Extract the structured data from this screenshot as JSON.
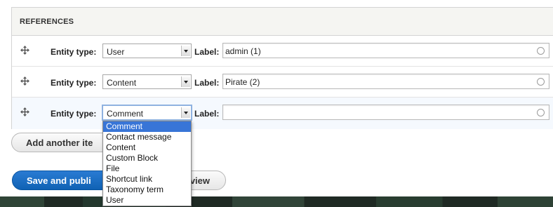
{
  "section_title": "REFERENCES",
  "entity_type_label": "Entity type:",
  "label_label": "Label:",
  "rows": [
    {
      "entity_type": "User",
      "label": "admin (1)"
    },
    {
      "entity_type": "Content",
      "label": "Pirate (2)"
    },
    {
      "entity_type": "Comment",
      "label": ""
    }
  ],
  "dropdown_options": [
    "Comment",
    "Contact message",
    "Content",
    "Custom Block",
    "File",
    "Shortcut link",
    "Taxonomy term",
    "User"
  ],
  "selected_option": "Comment",
  "buttons": {
    "add_another": "Add another ite",
    "save": "Save and publi",
    "preview": "view"
  },
  "colors": {
    "primary": "#0f62b4",
    "selection": "#3875d7"
  },
  "icons": {
    "drag_handle": "move-arrows-icon",
    "autocomplete": "autocomplete-throbber-icon",
    "select_arrow": "chevron-down-icon"
  }
}
